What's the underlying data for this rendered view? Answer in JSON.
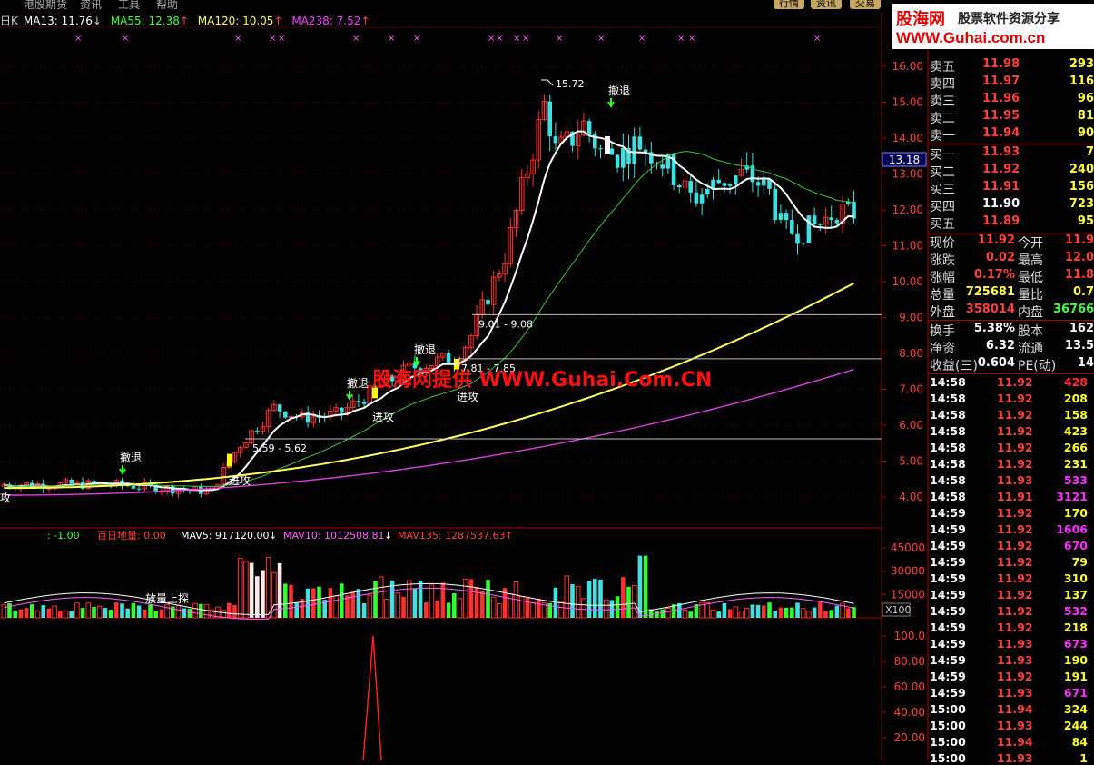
{
  "menu": [
    "港股期货",
    "资讯",
    "工具",
    "帮助"
  ],
  "top_tabs": [
    "行情",
    "资讯",
    "交易"
  ],
  "header": {
    "k_label": "日K",
    "ma13": "MA13: 11.76",
    "ma13_arrow": "↓",
    "ma55": "MA55: 12.38",
    "ma55_arrow": "↑",
    "ma120": "MA120: 10.05",
    "ma120_arrow": "↑",
    "ma238": "MA238: 7.52",
    "ma238_arrow": "↑"
  },
  "logo": {
    "brand": "股海网",
    "slogan": "股票软件资源分享",
    "url": "WWW.Guhai.com.cn"
  },
  "price_axis": [
    "16.00",
    "15.00",
    "14.00",
    "13.00",
    "12.00",
    "11.00",
    "10.00",
    "9.00",
    "8.00",
    "7.00",
    "6.00",
    "5.00",
    "4.00"
  ],
  "crosshair_price": "13.18",
  "annotations": {
    "high": "15.72",
    "band1": "9.01 - 9.08",
    "band2": "7.81 - 7.85",
    "band3": "5.59 - 5.62",
    "retreat": "撤退",
    "attack": "进攻",
    "volume_note": "放量上探",
    "center_watermark": "股海网提供 WWW.Guhai.Com.CN"
  },
  "volume_header": {
    "prefix": ": -1.00",
    "baiday": "百日地量: 0.00",
    "mav5": "MAV5: 917120.00",
    "mav5_arrow": "↓",
    "mav10": "MAV10: 1012508.81",
    "mav10_arrow": "↓",
    "mav135": "MAV135: 1287537.63",
    "mav135_arrow": "↑"
  },
  "volume_axis": [
    "45000",
    "30000",
    "15000"
  ],
  "volume_unit": "X100",
  "osc_axis": [
    "100.0",
    "80.00",
    "60.00",
    "40.00",
    "20.00"
  ],
  "order_book": {
    "asks": [
      {
        "label": "卖五",
        "price": "11.98",
        "vol": "293"
      },
      {
        "label": "卖四",
        "price": "11.97",
        "vol": "116"
      },
      {
        "label": "卖三",
        "price": "11.96",
        "vol": "96"
      },
      {
        "label": "卖二",
        "price": "11.95",
        "vol": "81"
      },
      {
        "label": "卖一",
        "price": "11.94",
        "vol": "90"
      }
    ],
    "bids": [
      {
        "label": "买一",
        "price": "11.93",
        "vol": "7"
      },
      {
        "label": "买二",
        "price": "11.92",
        "vol": "240"
      },
      {
        "label": "买三",
        "price": "11.91",
        "vol": "156"
      },
      {
        "label": "买四",
        "price": "11.90",
        "vol": "723"
      },
      {
        "label": "买五",
        "price": "11.89",
        "vol": "95"
      }
    ]
  },
  "stats": [
    {
      "l1": "现价",
      "v1": "11.92",
      "l2": "今开",
      "v2": "11.9"
    },
    {
      "l1": "涨跌",
      "v1": "0.02",
      "l2": "最高",
      "v2": "12.0"
    },
    {
      "l1": "涨幅",
      "v1": "0.17%",
      "l2": "最低",
      "v2": "11.8"
    },
    {
      "l1": "总量",
      "v1": "725681",
      "l2": "量比",
      "v2": "0.7"
    },
    {
      "l1": "外盘",
      "v1": "358014",
      "l2": "内盘",
      "v2": "36766"
    },
    {
      "l1": "换手",
      "v1": "5.38%",
      "l2": "股本",
      "v2": "162"
    },
    {
      "l1": "净资",
      "v1": "6.32",
      "l2": "流通",
      "v2": "13.5"
    },
    {
      "l1": "收益(三)",
      "v1": "0.604",
      "l2": "PE(动)",
      "v2": "14"
    }
  ],
  "ticks": [
    {
      "t": "14:58",
      "p": "11.92",
      "v": "428",
      "c": "#ff3030"
    },
    {
      "t": "14:58",
      "p": "11.92",
      "v": "208",
      "c": "#ffff30"
    },
    {
      "t": "14:58",
      "p": "11.92",
      "v": "158",
      "c": "#ffff30"
    },
    {
      "t": "14:58",
      "p": "11.92",
      "v": "423",
      "c": "#ffff30"
    },
    {
      "t": "14:58",
      "p": "11.92",
      "v": "266",
      "c": "#ffff30"
    },
    {
      "t": "14:58",
      "p": "11.92",
      "v": "231",
      "c": "#ffff30"
    },
    {
      "t": "14:58",
      "p": "11.93",
      "v": "533",
      "c": "#ff30ff"
    },
    {
      "t": "14:58",
      "p": "11.91",
      "v": "3121",
      "c": "#ff30ff"
    },
    {
      "t": "14:59",
      "p": "11.92",
      "v": "170",
      "c": "#ffff30"
    },
    {
      "t": "14:59",
      "p": "11.92",
      "v": "1606",
      "c": "#ff30ff"
    },
    {
      "t": "14:59",
      "p": "11.92",
      "v": "670",
      "c": "#ff30ff"
    },
    {
      "t": "14:59",
      "p": "11.92",
      "v": "79",
      "c": "#ffff30"
    },
    {
      "t": "14:59",
      "p": "11.92",
      "v": "310",
      "c": "#ffff30"
    },
    {
      "t": "14:59",
      "p": "11.92",
      "v": "137",
      "c": "#ffff30"
    },
    {
      "t": "14:59",
      "p": "11.92",
      "v": "532",
      "c": "#ff30ff"
    },
    {
      "t": "14:59",
      "p": "11.92",
      "v": "218",
      "c": "#ffff30"
    },
    {
      "t": "14:59",
      "p": "11.93",
      "v": "673",
      "c": "#ff30ff"
    },
    {
      "t": "14:59",
      "p": "11.93",
      "v": "190",
      "c": "#ffff30"
    },
    {
      "t": "14:59",
      "p": "11.92",
      "v": "191",
      "c": "#ffff30"
    },
    {
      "t": "14:59",
      "p": "11.93",
      "v": "671",
      "c": "#ff30ff"
    },
    {
      "t": "15:00",
      "p": "11.94",
      "v": "324",
      "c": "#ffff30"
    },
    {
      "t": "15:00",
      "p": "11.93",
      "v": "244",
      "c": "#ffff30"
    },
    {
      "t": "15:00",
      "p": "11.94",
      "v": "84",
      "c": "#ffff30"
    },
    {
      "t": "15:00",
      "p": "11.93",
      "v": "1",
      "c": "#ffff30"
    }
  ]
}
